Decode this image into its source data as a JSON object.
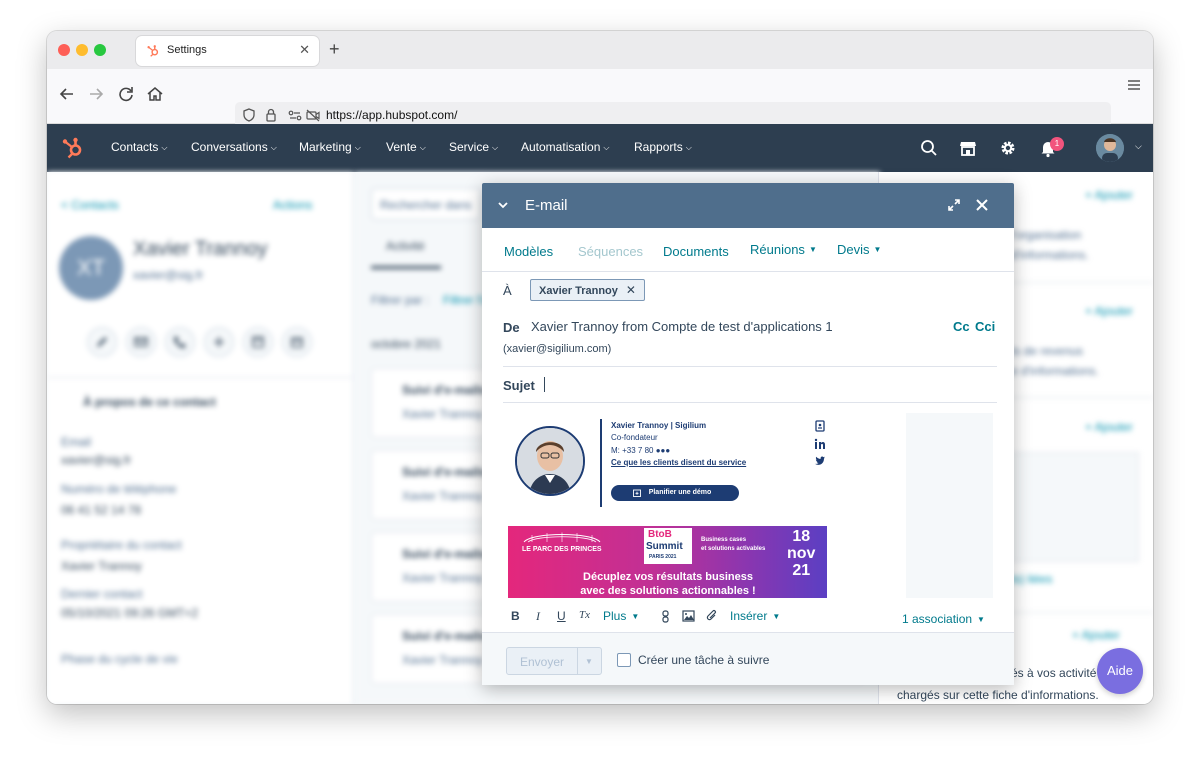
{
  "browser": {
    "tab_title": "Settings",
    "tab_close": "✕",
    "new_tab": "+",
    "url": "https://app.hubspot.com/"
  },
  "hs_nav": {
    "items": [
      {
        "label": "Contacts"
      },
      {
        "label": "Conversations"
      },
      {
        "label": "Marketing"
      },
      {
        "label": "Vente"
      },
      {
        "label": "Service"
      },
      {
        "label": "Automatisation"
      },
      {
        "label": "Rapports"
      }
    ],
    "notification_count": "1"
  },
  "background": {
    "left": {
      "back_link": "< Contacts",
      "actions": "Actions",
      "initials": "XT",
      "contact_name": "Xavier Trannoy",
      "contact_email": "xavier@sig.fr",
      "about": "À propos de ce contact",
      "email_label": "Email",
      "email_value": "xavier@sig.fr",
      "phone_label": "Numéro de téléphone",
      "phone_value": "06 41 52 14 78",
      "owner_label": "Propriétaire du contact",
      "owner_value": "Xavier Trannoy",
      "last_contact_label": "Dernier contact",
      "last_contact_value": "05/10/2021 09:26 GMT+2",
      "lifecycle_label": "Phase du cycle de vie"
    },
    "mid": {
      "search_placeholder": "Rechercher dans",
      "tab_activity": "Activité",
      "filter": "Filtrer par :",
      "filter_link": "Filtrer l'a",
      "month": "octobre 2021",
      "card_title": "Suivi d'e-mails",
      "card_sub": "Xavier Trannoy"
    },
    "right": {
      "add": "+ Ajouter",
      "line1": "l'organisation",
      "line2": "d'informations.",
      "line3": "ts de revenus",
      "line4": "e d'informations.",
      "link": "ts) liées",
      "line5": "és à vos activité",
      "line6": "chargés sur cette fiche d'informations."
    }
  },
  "email_modal": {
    "title": "E-mail",
    "tabs": {
      "templates": "Modèles",
      "sequences": "Séquences",
      "documents": "Documents",
      "meetings": "Réunions",
      "quotes": "Devis"
    },
    "to_label": "À",
    "recipient": "Xavier Trannoy",
    "from_label": "De",
    "from_value": "Xavier Trannoy from Compte de test d'applications 1",
    "from_email": "(xavier@sigilium.com)",
    "cc": "Cc",
    "bcc": "Cci",
    "subject_label": "Sujet",
    "signature": {
      "name": "Xavier Trannoy | Sigilium",
      "title": "Co-fondateur",
      "phone": "M: +33 7 80 ●●●",
      "link": "Ce que les clients disent du service",
      "demo": "Planifier une démo",
      "banner": {
        "venue": "LE PARC DES PRINCES",
        "btob": "BtoB",
        "summit": "Summit",
        "city": "PARIS 2021",
        "cases_1": "Business cases",
        "cases_2": "et solutions activables",
        "day": "18",
        "month": "nov",
        "year": "21",
        "headline_1": "Décuplez vos résultats business",
        "headline_2": "avec des solutions actionnables !"
      }
    },
    "toolbar": {
      "bold": "B",
      "italic": "I",
      "underline": "U",
      "clear": "Tx",
      "more": "Plus",
      "insert": "Insérer",
      "association": "1 association"
    },
    "footer": {
      "send": "Envoyer",
      "follow_up": "Créer une tâche à suivre"
    }
  },
  "help": "Aide"
}
